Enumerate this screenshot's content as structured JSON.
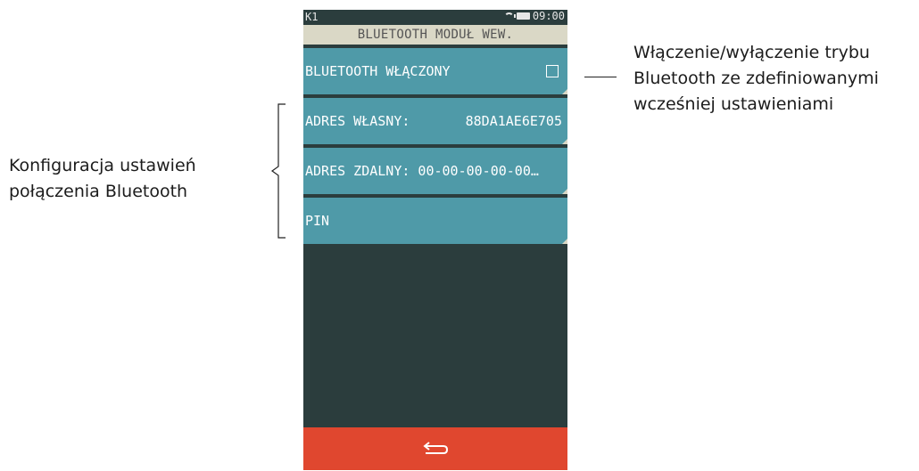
{
  "status_bar": {
    "left_text": "K1",
    "time": "09:00",
    "icons": [
      "wifi-icon",
      "battery-icon"
    ]
  },
  "header": {
    "title": "BLUETOOTH MODUŁ WEW."
  },
  "menu": [
    {
      "label": "BLUETOOTH WŁĄCZONY",
      "value": "",
      "checkbox": true,
      "checked": false
    },
    {
      "label": "ADRES WŁASNY:",
      "value": "88DA1AE6E705"
    },
    {
      "label": "ADRES ZDALNY: 00-00-00-00-00…",
      "value": ""
    },
    {
      "label": "PIN",
      "value": ""
    }
  ],
  "footer": {
    "back_icon": "back-arrow-icon"
  },
  "annotations": {
    "left": [
      "Konfiguracja ustawień",
      "połączenia Bluetooth"
    ],
    "right": [
      "Włączenie/wyłączenie trybu",
      "Bluetooth ze zdefiniowanymi",
      "wcześniej ustawieniami"
    ]
  },
  "colors": {
    "background": "#2b3d3d",
    "title_bar": "#dad8c6",
    "menu_item": "#4f9aa8",
    "footer": "#e0472f"
  }
}
